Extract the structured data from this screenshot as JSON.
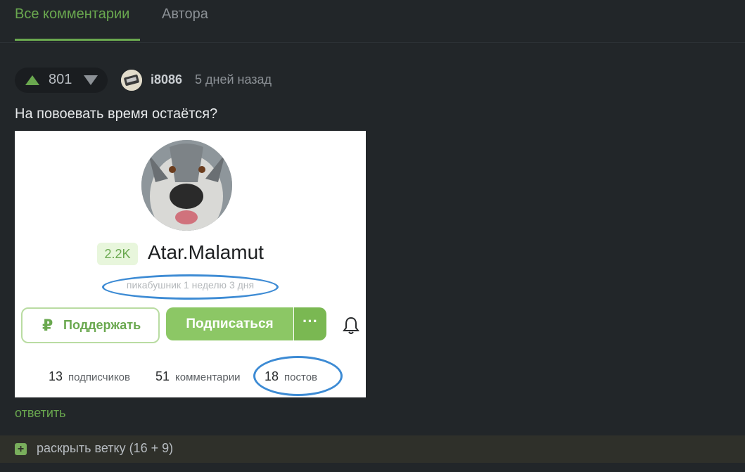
{
  "tabs": {
    "all_comments": "Все комментарии",
    "author": "Автора"
  },
  "comment": {
    "rating": "801",
    "username": "i8086",
    "timestamp": "5 дней назад",
    "text": "На повоевать время остаётся?",
    "reply_label": "ответить"
  },
  "embedded_profile": {
    "badge": "2.2K",
    "name": "Atar.Malamut",
    "tenure": "пикабушник 1 неделю 3 дня",
    "support_icon": "₽",
    "support_label": "Поддержать",
    "subscribe_label": "Подписаться",
    "more_label": "···",
    "stats": [
      {
        "value": "13",
        "label": "подписчиков"
      },
      {
        "value": "51",
        "label": "комментарии"
      },
      {
        "value": "18",
        "label": "постов"
      }
    ]
  },
  "thread": {
    "expand_icon": "+",
    "expand_label": "раскрыть ветку (16 + 9)"
  },
  "colors": {
    "accent": "#6aa84f",
    "background": "#222629",
    "annotation_oval": "#3d8bd4"
  }
}
